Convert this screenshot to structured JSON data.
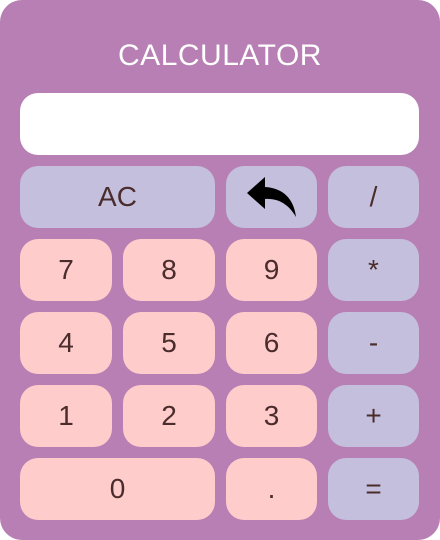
{
  "title": "CALCULATOR",
  "display": {
    "value": ""
  },
  "keys": {
    "clear": "AC",
    "backspace_icon": "undo-arrow-icon",
    "divide": "/",
    "seven": "7",
    "eight": "8",
    "nine": "9",
    "multiply": "*",
    "four": "4",
    "five": "5",
    "six": "6",
    "subtract": "-",
    "one": "1",
    "two": "2",
    "three": "3",
    "add": "+",
    "zero": "0",
    "decimal": ".",
    "equals": "="
  },
  "colors": {
    "body": "#b77fb3",
    "number_key": "#ffcccc",
    "operator_key": "#c3bfdd",
    "display": "#ffffff",
    "key_text": "#4a2c2c"
  }
}
